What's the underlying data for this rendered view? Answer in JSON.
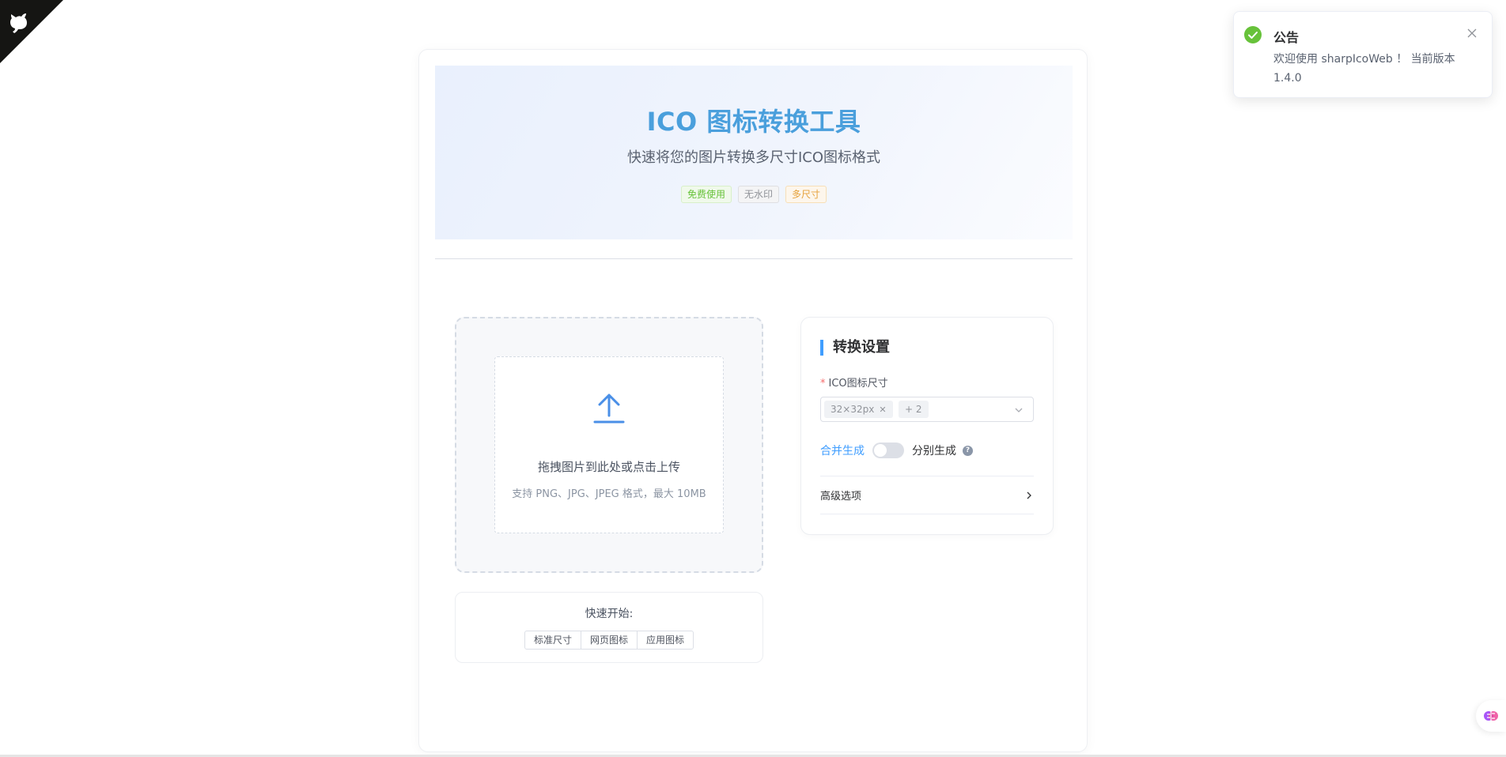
{
  "hero": {
    "title": "ICO 图标转换工具",
    "subtitle": "快速将您的图片转换多尺寸ICO图标格式",
    "tags": [
      "免费使用",
      "无水印",
      "多尺寸"
    ]
  },
  "upload": {
    "text": "拖拽图片到此处或点击上传",
    "hint": "支持 PNG、JPG、JPEG 格式，最大 10MB"
  },
  "quick_start": {
    "title": "快速开始:",
    "buttons": [
      "标准尺寸",
      "网页图标",
      "应用图标"
    ]
  },
  "settings": {
    "title": "转换设置",
    "size_label": "ICO图标尺寸",
    "required_mark": "*",
    "selected_sizes": [
      "32×32px",
      "+ 2"
    ],
    "mode_merge": "合并生成",
    "mode_separate": "分别生成",
    "help": "?",
    "advanced": "高级选项"
  },
  "notice": {
    "title": "公告",
    "body": "欢迎使用 sharpIcoWeb ！ 当前版本 1.4.0"
  },
  "colors": {
    "accent": "#409eff",
    "title": "#4a9fdc",
    "success": "#67c23a"
  }
}
